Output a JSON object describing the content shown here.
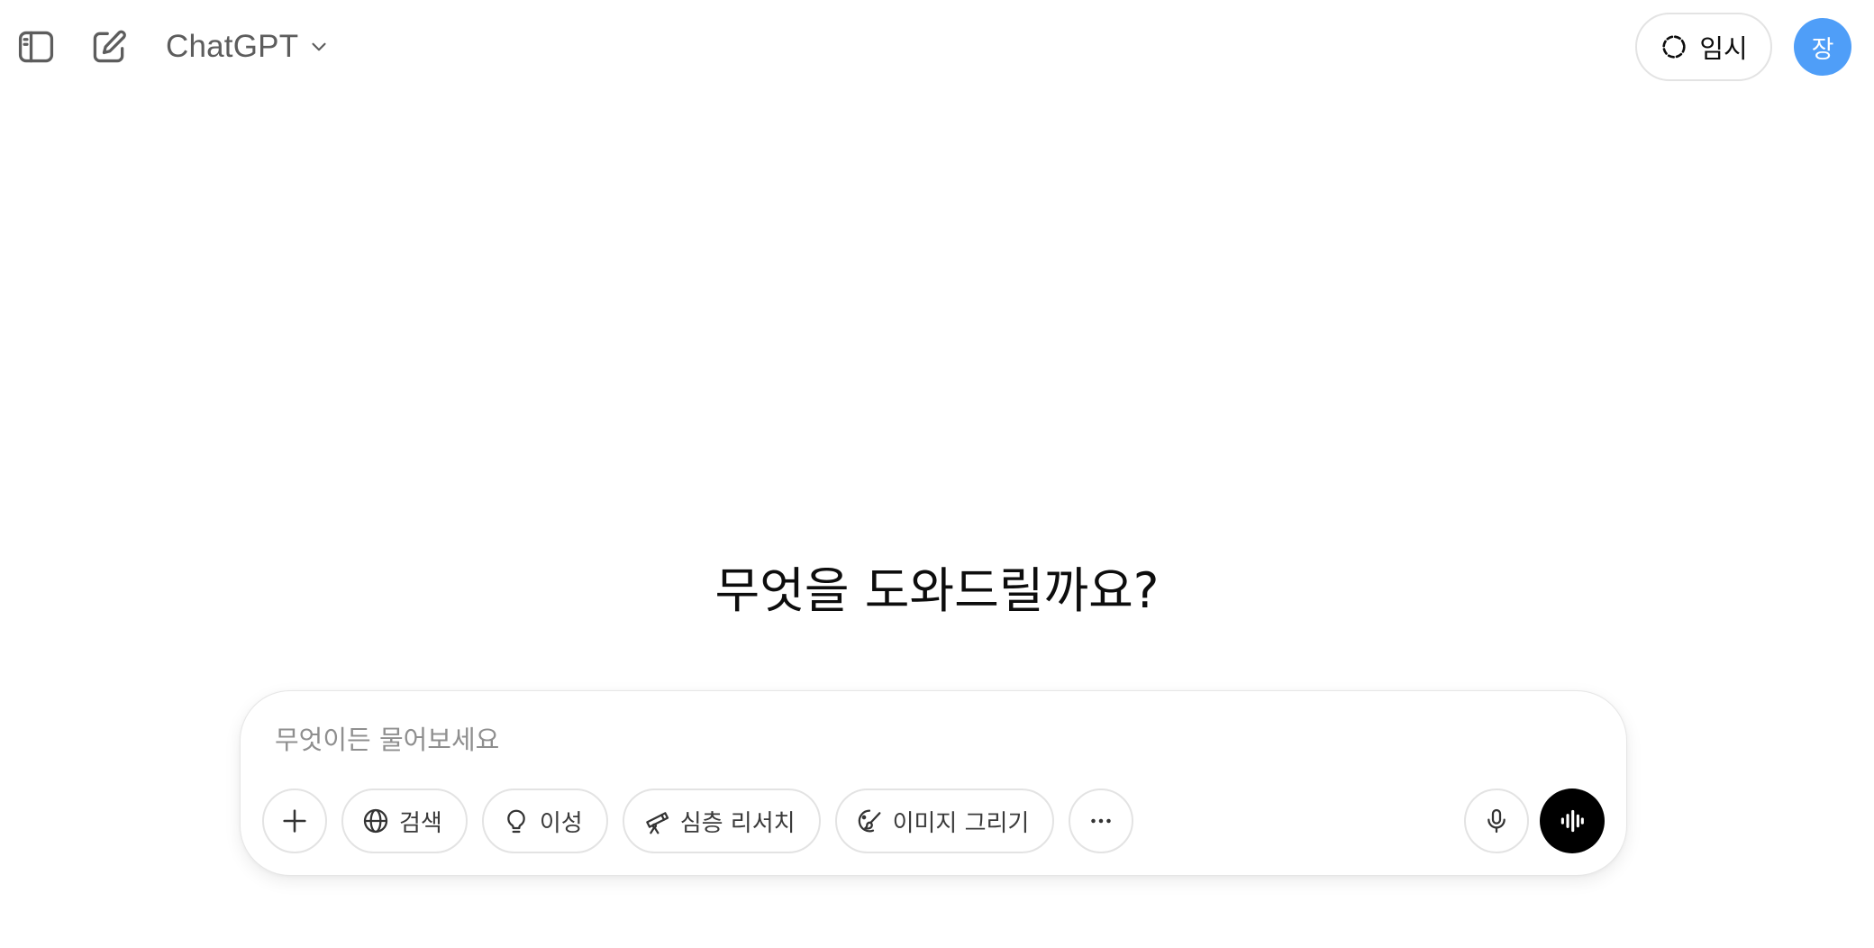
{
  "header": {
    "model_name": "ChatGPT",
    "temporary_label": "임시",
    "avatar_initial": "장",
    "icons": {
      "sidebar": "sidebar-toggle-icon",
      "new_chat": "edit-icon",
      "model_dropdown": "chevron-down-icon",
      "temporary": "dashed-circle-icon"
    }
  },
  "main": {
    "headline": "무엇을 도와드릴까요?"
  },
  "composer": {
    "placeholder": "무엇이든 물어보세요",
    "value": "",
    "tools": [
      {
        "label": "검색",
        "icon": "globe-icon"
      },
      {
        "label": "이성",
        "icon": "lightbulb-icon"
      },
      {
        "label": "심층 리서치",
        "icon": "telescope-icon"
      },
      {
        "label": "이미지 그리기",
        "icon": "paintbrush-icon"
      }
    ],
    "icons": {
      "add": "plus-icon",
      "more": "more-icon",
      "mic": "microphone-icon",
      "voice": "voice-mode-icon"
    }
  },
  "colors": {
    "avatar_bg": "#4f9ef8",
    "voice_button_bg": "#000000",
    "border": "#e3e3e3",
    "placeholder": "#8f8f8f"
  }
}
